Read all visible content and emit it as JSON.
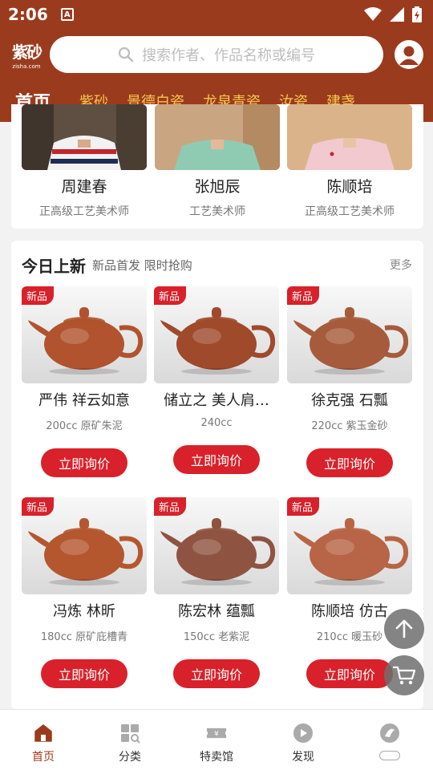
{
  "status_bar": {
    "time": "2:06",
    "notification": "A"
  },
  "header": {
    "logo_text": "紫砂",
    "logo_subtext": "zisha.com",
    "search_placeholder": "搜索作者、作品名称或编号",
    "nav_tabs": [
      {
        "label": "首页",
        "active": true
      },
      {
        "label": "紫砂",
        "active": false
      },
      {
        "label": "景德白瓷",
        "active": false
      },
      {
        "label": "龙泉青瓷",
        "active": false
      },
      {
        "label": "汝瓷",
        "active": false
      },
      {
        "label": "建盏",
        "active": false
      }
    ]
  },
  "artists": [
    {
      "name": "周建春",
      "title": "正高级工艺美术师"
    },
    {
      "name": "张旭辰",
      "title": "工艺美术师"
    },
    {
      "name": "陈顺培",
      "title": "正高级工艺美术师"
    }
  ],
  "new_arrivals": {
    "title": "今日上新",
    "subtitle": "新品首发 限时抢购",
    "more": "更多",
    "badge": "新品",
    "button_label": "立即询价",
    "products": [
      {
        "name": "严伟 祥云如意",
        "spec": "200cc 原矿朱泥",
        "color": "#b0532e"
      },
      {
        "name": "储立之 美人肩…",
        "spec": "240cc",
        "color": "#9e4a2b"
      },
      {
        "name": "徐克强 石瓢",
        "spec": "220cc 紫玉金砂",
        "color": "#a65b3c"
      },
      {
        "name": "冯炼 林昕",
        "spec": "180cc 原矿庇槽青",
        "color": "#b4572f"
      },
      {
        "name": "陈宏林 蕴瓢",
        "spec": "150cc 老紫泥",
        "color": "#8f5341"
      },
      {
        "name": "陈顺培 仿古",
        "spec": "210cc 暖玉砂",
        "color": "#b86446"
      }
    ]
  },
  "bottom_nav": [
    {
      "label": "首页",
      "icon": "home-icon",
      "active": true
    },
    {
      "label": "分类",
      "icon": "category-icon",
      "active": false
    },
    {
      "label": "特卖馆",
      "icon": "ticket-icon",
      "active": false
    },
    {
      "label": "发现",
      "icon": "play-icon",
      "active": false
    },
    {
      "label": "",
      "icon": "community-icon",
      "active": false
    }
  ],
  "colors": {
    "brand": "#9b3b1d",
    "accent": "#d8212a",
    "tab_text": "#f5c84a"
  }
}
